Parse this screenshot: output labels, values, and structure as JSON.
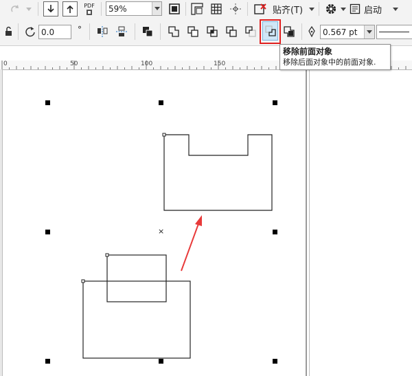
{
  "toolbar_top": {
    "zoom_value": "59%",
    "pdf_label": "PDF",
    "snap_label": "贴齐(T)",
    "launch_label": "启动"
  },
  "toolbar_property": {
    "rotation_value": "0.0",
    "degree_symbol": "°",
    "outline_width": "0.567 pt"
  },
  "tooltip": {
    "title": "移除前面对象",
    "description": "移除后面对象中的前面对象."
  },
  "ruler": {
    "labels": [
      "0",
      "50",
      "100",
      "150"
    ]
  },
  "canvas": {
    "center_marker": "×"
  },
  "colors": {
    "highlight": "#e02020",
    "arrow": "#e83a3a",
    "active_button": "#cfe6f7"
  }
}
